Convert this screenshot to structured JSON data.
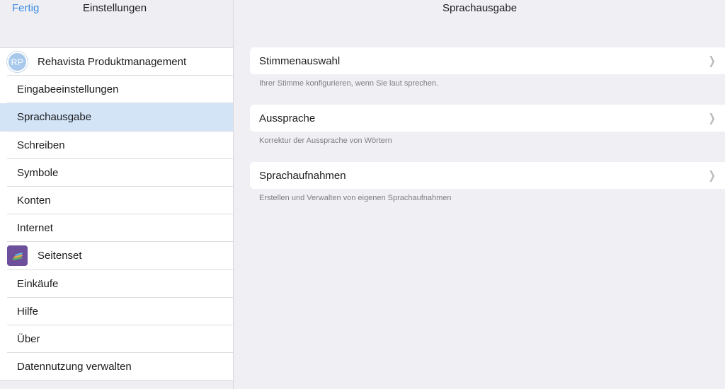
{
  "left": {
    "done_label": "Fertig",
    "title": "Einstellungen",
    "account": {
      "initials": "RP",
      "name": "Rehavista Produktmanagement"
    },
    "items": [
      {
        "label": "Eingabeeinstellungen"
      },
      {
        "label": "Sprachausgabe",
        "selected": true
      },
      {
        "label": "Schreiben"
      },
      {
        "label": "Symbole"
      },
      {
        "label": "Konten"
      },
      {
        "label": "Internet"
      },
      {
        "label": "Seitenset",
        "icon": "pageset-icon"
      },
      {
        "label": "Einkäufe"
      },
      {
        "label": "Hilfe"
      },
      {
        "label": "Über"
      },
      {
        "label": "Datennutzung verwalten"
      }
    ]
  },
  "right": {
    "title": "Sprachausgabe",
    "groups": [
      {
        "label": "Stimmenauswahl",
        "footer": "Ihrer Stimme konfigurieren, wenn Sie laut sprechen."
      },
      {
        "label": "Aussprache",
        "footer": "Korrektur der Aussprache von Wörtern"
      },
      {
        "label": "Sprachaufnahmen",
        "footer": "Erstellen und Verwalten von eigenen Sprachaufnahmen"
      }
    ]
  },
  "colors": {
    "accent": "#3a8ee6",
    "selected_row": "#d3e4f7",
    "pageset_icon": "#6e4f9c",
    "avatar": "#a9c9ec"
  }
}
